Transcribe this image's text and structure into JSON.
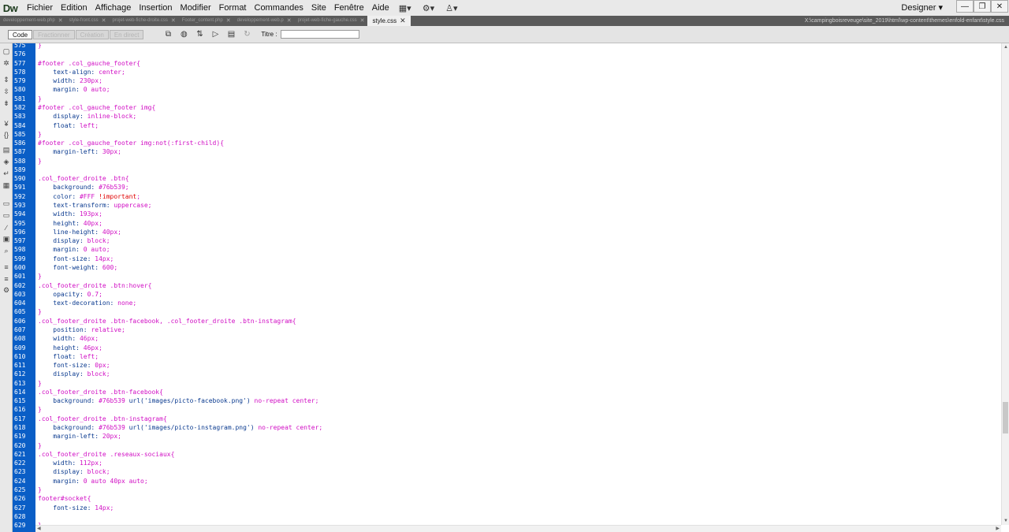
{
  "app": {
    "logo": "Dw",
    "menu": [
      "Fichier",
      "Edition",
      "Affichage",
      "Insertion",
      "Modifier",
      "Format",
      "Commandes",
      "Site",
      "Fenêtre",
      "Aide"
    ],
    "workspace": "Designer"
  },
  "tabs": [
    {
      "label": "developpement-web.php"
    },
    {
      "label": "style-front.css"
    },
    {
      "label": "projet-web-fiche-droite.css"
    },
    {
      "label": "Footer_content.php"
    },
    {
      "label": "developpement-web.p"
    },
    {
      "label": "projet-web-fiche-gauche.css"
    },
    {
      "label": "style.css",
      "active": true
    }
  ],
  "filepath": "X:\\campingboisreveuge\\site_2019\\html\\wp-content\\themes\\enfold-enfant\\style.css",
  "toolbar": {
    "views": [
      "Code",
      "Fractionner",
      "Création",
      "En direct"
    ],
    "title_label": "Titre :",
    "title_value": ""
  },
  "editor": {
    "lines": [
      {
        "n": "575",
        "t": [
          [
            "sel",
            "}"
          ]
        ]
      },
      {
        "n": "576",
        "t": []
      },
      {
        "n": "577",
        "t": [
          [
            "sel",
            "#footer .col_gauche_footer{"
          ]
        ]
      },
      {
        "n": "578",
        "t": [
          [
            "prop",
            "    text-align: "
          ],
          [
            "val",
            "center;"
          ]
        ]
      },
      {
        "n": "579",
        "t": [
          [
            "prop",
            "    width: "
          ],
          [
            "val",
            "230px;"
          ]
        ]
      },
      {
        "n": "580",
        "t": [
          [
            "prop",
            "    margin: "
          ],
          [
            "val",
            "0 auto;"
          ]
        ]
      },
      {
        "n": "581",
        "t": [
          [
            "sel",
            "}"
          ]
        ]
      },
      {
        "n": "582",
        "t": [
          [
            "sel",
            "#footer .col_gauche_footer img{"
          ]
        ]
      },
      {
        "n": "583",
        "t": [
          [
            "prop",
            "    display: "
          ],
          [
            "val",
            "inline-block;"
          ]
        ]
      },
      {
        "n": "584",
        "t": [
          [
            "prop",
            "    float: "
          ],
          [
            "val",
            "left;"
          ]
        ]
      },
      {
        "n": "585",
        "t": [
          [
            "sel",
            "}"
          ]
        ]
      },
      {
        "n": "586",
        "t": [
          [
            "sel",
            "#footer .col_gauche_footer img:not(:first-child){"
          ]
        ]
      },
      {
        "n": "587",
        "t": [
          [
            "prop",
            "    margin-left: "
          ],
          [
            "val",
            "30px;"
          ]
        ]
      },
      {
        "n": "588",
        "t": [
          [
            "sel",
            "}"
          ]
        ]
      },
      {
        "n": "589",
        "t": []
      },
      {
        "n": "590",
        "t": [
          [
            "sel",
            ".col_footer_droite .btn{"
          ]
        ]
      },
      {
        "n": "591",
        "t": [
          [
            "prop",
            "    background: "
          ],
          [
            "val",
            "#76b539;"
          ]
        ]
      },
      {
        "n": "592",
        "t": [
          [
            "prop",
            "    color: "
          ],
          [
            "val",
            "#FFF "
          ],
          [
            "imp",
            "!important"
          ],
          [
            "val",
            ";"
          ]
        ]
      },
      {
        "n": "593",
        "t": [
          [
            "prop",
            "    text-transform: "
          ],
          [
            "val",
            "uppercase;"
          ]
        ]
      },
      {
        "n": "594",
        "t": [
          [
            "prop",
            "    width: "
          ],
          [
            "val",
            "193px;"
          ]
        ]
      },
      {
        "n": "595",
        "t": [
          [
            "prop",
            "    height: "
          ],
          [
            "val",
            "40px;"
          ]
        ]
      },
      {
        "n": "596",
        "t": [
          [
            "prop",
            "    line-height: "
          ],
          [
            "val",
            "40px;"
          ]
        ]
      },
      {
        "n": "597",
        "t": [
          [
            "prop",
            "    display: "
          ],
          [
            "val",
            "block;"
          ]
        ]
      },
      {
        "n": "598",
        "t": [
          [
            "prop",
            "    margin: "
          ],
          [
            "val",
            "0 auto;"
          ]
        ]
      },
      {
        "n": "599",
        "t": [
          [
            "prop",
            "    font-size: "
          ],
          [
            "val",
            "14px;"
          ]
        ]
      },
      {
        "n": "600",
        "t": [
          [
            "prop",
            "    font-weight: "
          ],
          [
            "val",
            "600;"
          ]
        ]
      },
      {
        "n": "601",
        "t": [
          [
            "sel",
            "}"
          ]
        ]
      },
      {
        "n": "602",
        "t": [
          [
            "sel",
            ".col_footer_droite .btn:hover{"
          ]
        ]
      },
      {
        "n": "603",
        "t": [
          [
            "prop",
            "    opacity: "
          ],
          [
            "val",
            "0.7;"
          ]
        ]
      },
      {
        "n": "604",
        "t": [
          [
            "prop",
            "    text-decoration: "
          ],
          [
            "val",
            "none;"
          ]
        ]
      },
      {
        "n": "605",
        "t": [
          [
            "sel",
            "}"
          ]
        ]
      },
      {
        "n": "606",
        "t": [
          [
            "sel",
            ".col_footer_droite .btn-facebook, .col_footer_droite .btn-instagram{"
          ]
        ]
      },
      {
        "n": "607",
        "t": [
          [
            "prop",
            "    position: "
          ],
          [
            "val",
            "relative;"
          ]
        ]
      },
      {
        "n": "608",
        "t": [
          [
            "prop",
            "    width: "
          ],
          [
            "val",
            "46px;"
          ]
        ]
      },
      {
        "n": "609",
        "t": [
          [
            "prop",
            "    height: "
          ],
          [
            "val",
            "46px;"
          ]
        ]
      },
      {
        "n": "610",
        "t": [
          [
            "prop",
            "    float: "
          ],
          [
            "val",
            "left;"
          ]
        ]
      },
      {
        "n": "611",
        "t": [
          [
            "prop",
            "    font-size: "
          ],
          [
            "val",
            "0px;"
          ]
        ]
      },
      {
        "n": "612",
        "t": [
          [
            "prop",
            "    display: "
          ],
          [
            "val",
            "block;"
          ]
        ]
      },
      {
        "n": "613",
        "t": [
          [
            "sel",
            "}"
          ]
        ]
      },
      {
        "n": "614",
        "t": [
          [
            "sel",
            ".col_footer_droite .btn-facebook{"
          ]
        ]
      },
      {
        "n": "615",
        "t": [
          [
            "prop",
            "    background: "
          ],
          [
            "val",
            "#76b539 "
          ],
          [
            "prop",
            "url('images/picto-facebook.png') "
          ],
          [
            "val",
            "no-repeat center;"
          ]
        ]
      },
      {
        "n": "616",
        "t": [
          [
            "sel",
            "}"
          ]
        ]
      },
      {
        "n": "617",
        "t": [
          [
            "sel",
            ".col_footer_droite .btn-instagram{"
          ]
        ]
      },
      {
        "n": "618",
        "t": [
          [
            "prop",
            "    background: "
          ],
          [
            "val",
            "#76b539 "
          ],
          [
            "prop",
            "url('images/picto-instagram.png') "
          ],
          [
            "val",
            "no-repeat center;"
          ]
        ]
      },
      {
        "n": "619",
        "t": [
          [
            "prop",
            "    margin-left: "
          ],
          [
            "val",
            "20px;"
          ]
        ]
      },
      {
        "n": "620",
        "t": [
          [
            "sel",
            "}"
          ]
        ]
      },
      {
        "n": "621",
        "t": [
          [
            "sel",
            ".col_footer_droite .reseaux-sociaux{"
          ]
        ]
      },
      {
        "n": "622",
        "t": [
          [
            "prop",
            "    width: "
          ],
          [
            "val",
            "112px;"
          ]
        ]
      },
      {
        "n": "623",
        "t": [
          [
            "prop",
            "    display: "
          ],
          [
            "val",
            "block;"
          ]
        ]
      },
      {
        "n": "624",
        "t": [
          [
            "prop",
            "    margin: "
          ],
          [
            "val",
            "0 auto 40px auto;"
          ]
        ]
      },
      {
        "n": "625",
        "t": [
          [
            "sel",
            "}"
          ]
        ]
      },
      {
        "n": "626",
        "t": [
          [
            "sel",
            "footer#socket{"
          ]
        ]
      },
      {
        "n": "627",
        "t": [
          [
            "prop",
            "    font-size: "
          ],
          [
            "val",
            "14px;"
          ]
        ]
      },
      {
        "n": "628",
        "t": []
      },
      {
        "n": "629",
        "t": [
          [
            "sel",
            "}"
          ]
        ]
      }
    ]
  },
  "colors": {
    "gutter": "#0a5ec6",
    "selector": "#d10ec4",
    "property": "#0a3a8f",
    "important": "#e00000"
  }
}
